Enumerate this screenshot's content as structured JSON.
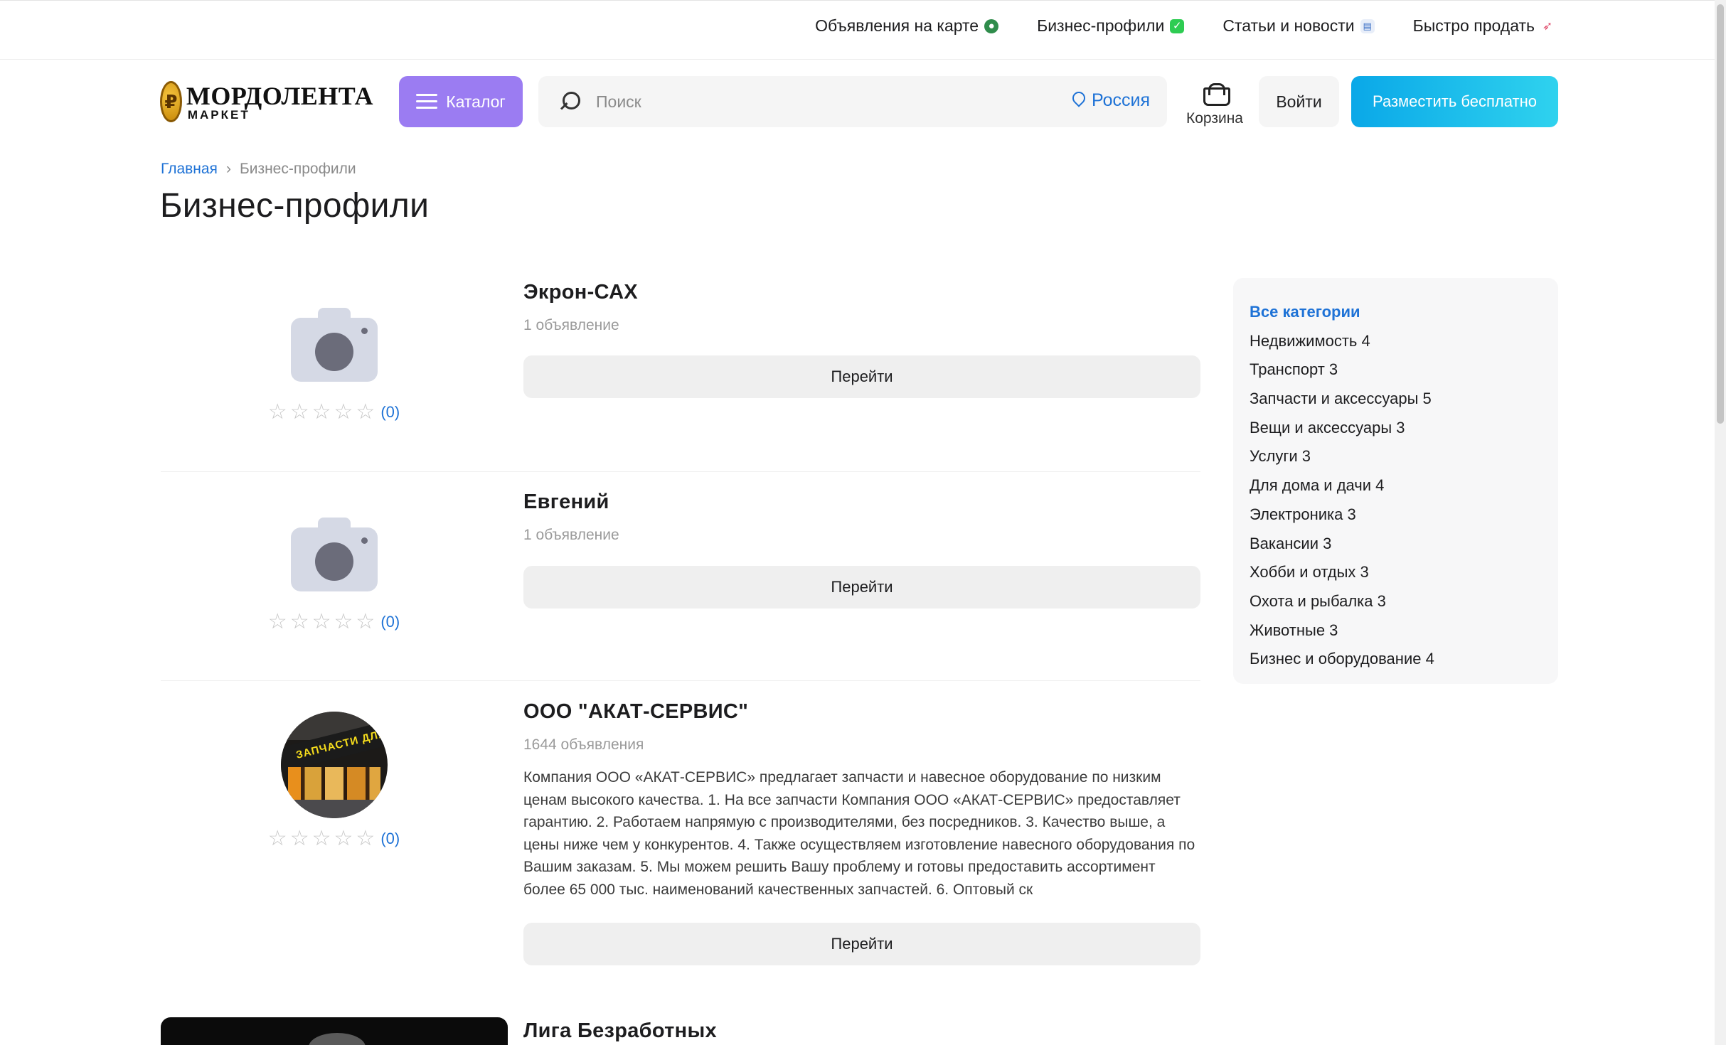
{
  "top_nav": [
    {
      "label": "Объявления на карте",
      "icon": "globe-icon"
    },
    {
      "label": "Бизнес-профили",
      "icon": "check-icon"
    },
    {
      "label": "Статьи и новости",
      "icon": "book-icon"
    },
    {
      "label": "Быстро продать",
      "icon": "rocket-icon"
    }
  ],
  "header": {
    "logo_title": "МОРДОЛЕНТА",
    "logo_subtitle": "МАРКЕТ",
    "catalog_label": "Каталог",
    "search_placeholder": "Поиск",
    "search_value": "",
    "region": "Россия",
    "cart_label": "Корзина",
    "login_label": "Войти",
    "post_label": "Разместить бесплатно"
  },
  "breadcrumb": {
    "home": "Главная",
    "separator": "›",
    "current": "Бизнес-профили"
  },
  "page_title": "Бизнес-профили",
  "profiles": [
    {
      "name": "Экрон-САХ",
      "ads_count": "1 объявление",
      "rating_count": "(0)",
      "rating_value": 0,
      "rating_max": 5,
      "has_photo": false,
      "description": "",
      "go_label": "Перейти"
    },
    {
      "name": "Евгений",
      "ads_count": "1 объявление",
      "rating_count": "(0)",
      "rating_value": 0,
      "rating_max": 5,
      "has_photo": false,
      "description": "",
      "go_label": "Перейти"
    },
    {
      "name": "ООО \"АКАТ-СЕРВИС\"",
      "ads_count": "1644 объявления",
      "rating_count": "(0)",
      "rating_value": 0,
      "rating_max": 5,
      "has_photo": true,
      "photo_sign_text": "ЗАПЧАСТИ ДЛЯ СПЕЦТЕХНИКИ",
      "description": "Компания ООО «АКАТ-СЕРВИС» предлагает запчасти и навесное оборудование по низким ценам высокого качества. 1. На все запчасти Компания ООО «АКАТ-СЕРВИС» предоставляет гарантию. 2. Работаем напрямую с производителями, без посредников. 3. Качество выше, а цены ниже чем у конкурентов. 4. Также осуществляем изготовление навесного оборудования по Вашим заказам. 5. Мы можем решить Вашу проблему и готовы предоставить ассортимент более 65 000 тыс. наименований качественных запчастей. 6. Оптовый ск",
      "go_label": "Перейти"
    },
    {
      "name": "Лига Безработных"
    }
  ],
  "sidebar": {
    "items": [
      {
        "label": "Все категории",
        "active": true
      },
      {
        "label": "Недвижимость 4"
      },
      {
        "label": "Транспорт 3"
      },
      {
        "label": "Запчасти и аксессуары 5"
      },
      {
        "label": "Вещи и аксессуары 3"
      },
      {
        "label": "Услуги 3"
      },
      {
        "label": "Для дома и дачи 4"
      },
      {
        "label": "Электроника 3"
      },
      {
        "label": "Вакансии 3"
      },
      {
        "label": "Хобби и отдых 3"
      },
      {
        "label": "Охота и рыбалка 3"
      },
      {
        "label": "Животные 3"
      },
      {
        "label": "Бизнес и оборудование 4"
      }
    ]
  },
  "colors": {
    "accent_blue": "#1e72d6",
    "catalog_purple": "#9b7cf2",
    "post_gradient_start": "#0aa8e8",
    "post_gradient_end": "#2fd2ee",
    "placeholder_gray": "#d5d9e5"
  }
}
